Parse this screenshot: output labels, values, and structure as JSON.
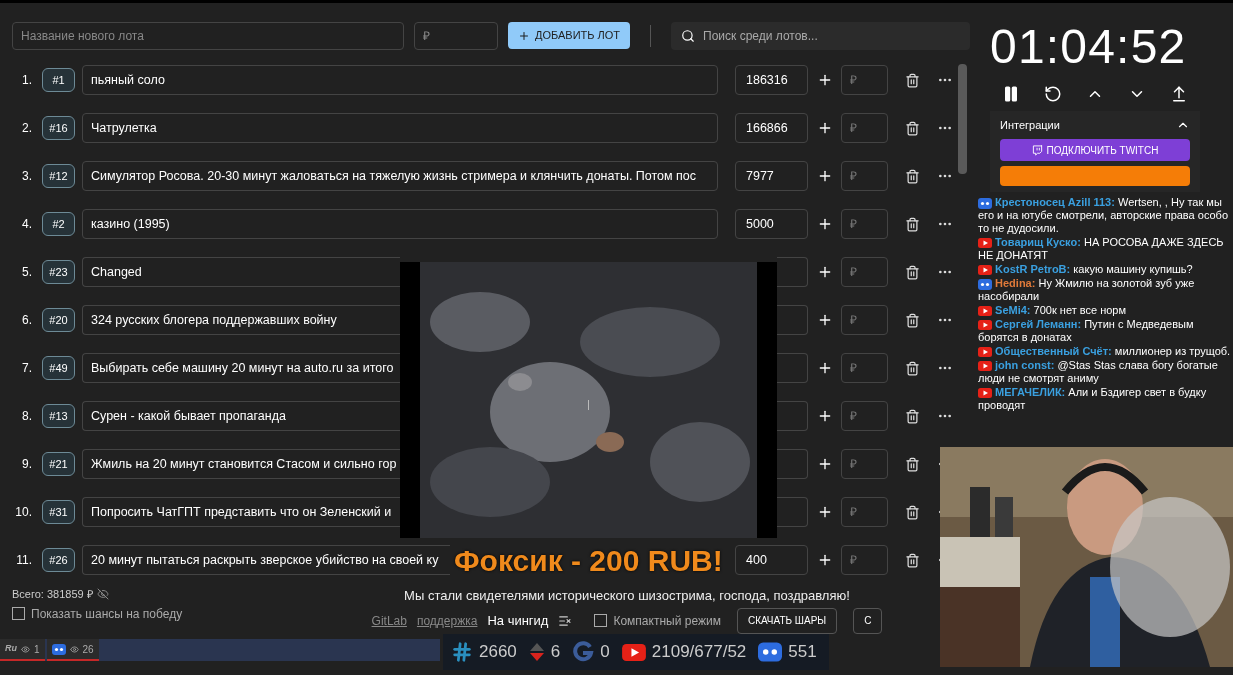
{
  "new_lot": {
    "name_placeholder": "Название нового лота",
    "amount_placeholder": "₽",
    "add_button": "ДОБАВИТЬ ЛОТ"
  },
  "search": {
    "placeholder": "Поиск среди лотов..."
  },
  "lots": [
    {
      "index": "1.",
      "id": "#1",
      "name": "пьяный соло",
      "amount": "186316",
      "add_placeholder": "₽"
    },
    {
      "index": "2.",
      "id": "#16",
      "name": "Чатрулетка",
      "amount": "166866",
      "add_placeholder": "₽"
    },
    {
      "index": "3.",
      "id": "#12",
      "name": "Симулятор Росова. 20-30 минут жаловаться на тяжелую жизнь стримера и клянчить донаты. Потом пос",
      "amount": "7977",
      "add_placeholder": "₽"
    },
    {
      "index": "4.",
      "id": "#2",
      "name": "казино (1995)",
      "amount": "5000",
      "add_placeholder": "₽"
    },
    {
      "index": "5.",
      "id": "#23",
      "name": "Changed",
      "add_placeholder": "₽"
    },
    {
      "index": "6.",
      "id": "#20",
      "name": "324 русских блогера поддержавших войну",
      "add_placeholder": "₽"
    },
    {
      "index": "7.",
      "id": "#49",
      "name": "Выбирать себе машину 20 минут на auto.ru за итого",
      "add_placeholder": "₽"
    },
    {
      "index": "8.",
      "id": "#13",
      "name": "Сурен - какой бывает пропаганда",
      "add_placeholder": "₽"
    },
    {
      "index": "9.",
      "id": "#21",
      "name": "Жмиль на 20 минут становится Стасом и сильно гор",
      "add_placeholder": "₽"
    },
    {
      "index": "10.",
      "id": "#31",
      "name": "Попросить ЧатГПТ представить что он Зеленский и",
      "add_placeholder": "₽"
    },
    {
      "index": "11.",
      "id": "#26",
      "name": "20 минут пытаться раскрыть зверское убийство на своей ку",
      "amount": "400",
      "add_placeholder": "₽"
    }
  ],
  "total": "Всего: 381859 ₽",
  "show_chances": {
    "label": "Показать шансы на победу",
    "checked": false
  },
  "footer": {
    "links": [
      "GitLab",
      "поддержка"
    ],
    "compact_mode": {
      "label": "Компактный режим",
      "checked": false
    },
    "buttons": [
      "СКАЧАТЬ ШАРЫ",
      "С"
    ]
  },
  "timer": {
    "time": "01:04:52"
  },
  "integrations": {
    "title": "Интеграции",
    "expanded": true,
    "twitch_button": "ПОДКЛЮЧИТЬ TWITCH"
  },
  "chat": [
    {
      "kind": "vk",
      "author": "Крестоносец Azill 113:",
      "color": "#3aa0e0",
      "text": "Wertsen, , Ну так мы его и на ютубе смотрели, авторские права особо то не дудосили."
    },
    {
      "kind": "youtube",
      "author": "Товарищ Кускo:",
      "color": "#3aa0e0",
      "text": "НА РОСОВА ДАЖЕ ЗДЕСЬ НЕ ДОНАТЯТ"
    },
    {
      "kind": "youtube",
      "author": "KostR PetroB:",
      "color": "#3aa0e0",
      "text": "какую машину купишь?"
    },
    {
      "kind": "vk",
      "author": "Hedina:",
      "color": "#e07a3a",
      "text": "Ну Жмилю на золотой зуб уже насобирали"
    },
    {
      "kind": "youtube",
      "author": "SeMi4:",
      "color": "#3aa0e0",
      "text": "700к нет все норм"
    },
    {
      "kind": "youtube",
      "author": "Сергей Леманн:",
      "color": "#3aa0e0",
      "text": "Путин с Медведевым борятся в донатах"
    },
    {
      "kind": "youtube",
      "author": "Общественный Счёт:",
      "color": "#3aa0e0",
      "text": "миллионер из трущоб."
    },
    {
      "kind": "youtube",
      "author": "john const:",
      "color": "#3aa0e0",
      "text": "@Stas Stas слава богу богатые люди не смотрят аниму"
    },
    {
      "kind": "youtube",
      "author": "МЕГАЧЕЛИК:",
      "color": "#3aa0e0",
      "text": "Али и Бздигер свет в будку проводят"
    }
  ],
  "overlay": {
    "alert": "Фоксик - 200 RUB!",
    "marquee": "Мы стали свидетелями исторического шизострима, господа, поздравляю!",
    "caption": "На чингид"
  },
  "stats": [
    {
      "kind": "hash",
      "value": "2660"
    },
    {
      "kind": "updown",
      "value": "6"
    },
    {
      "kind": "g",
      "value": "0"
    },
    {
      "kind": "youtube",
      "value": "2109/677/52"
    },
    {
      "kind": "vk",
      "value": "551"
    }
  ],
  "viewers": [
    {
      "kind": "ru",
      "label": "Ru",
      "value": "1"
    },
    {
      "kind": "vk",
      "value": "26"
    }
  ]
}
